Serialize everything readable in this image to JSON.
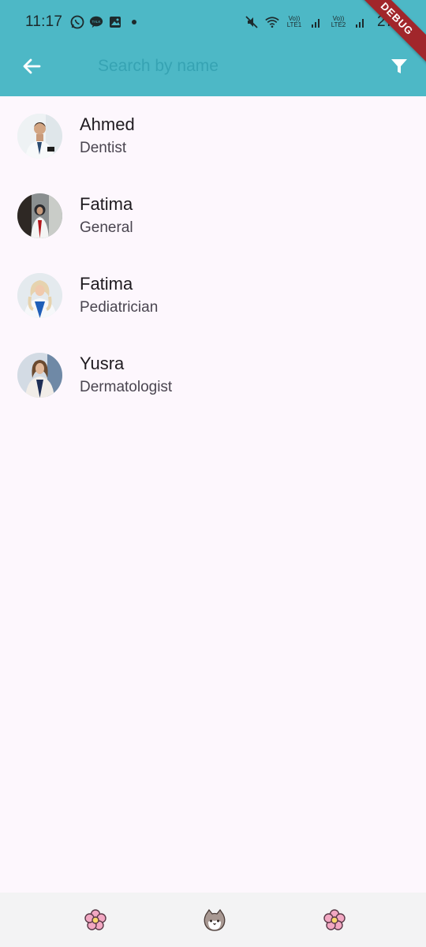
{
  "status_bar": {
    "time": "11:17",
    "battery": "27%",
    "net1": "Vo)) LTE1",
    "net2": "Vo)) LTE2"
  },
  "app_bar": {
    "search_placeholder": "Search by name",
    "accent_color": "#4db8c6"
  },
  "debug_banner": "DEBUG",
  "doctors": [
    {
      "name": "Ahmed",
      "specialty": "Dentist"
    },
    {
      "name": "Fatima",
      "specialty": "General"
    },
    {
      "name": "Fatima",
      "specialty": "Pediatrician"
    },
    {
      "name": "Yusra",
      "specialty": "Dermatologist"
    }
  ],
  "bottom_nav": {
    "items": [
      {
        "icon": "flower-icon"
      },
      {
        "icon": "cat-icon"
      },
      {
        "icon": "flower-icon"
      }
    ]
  }
}
